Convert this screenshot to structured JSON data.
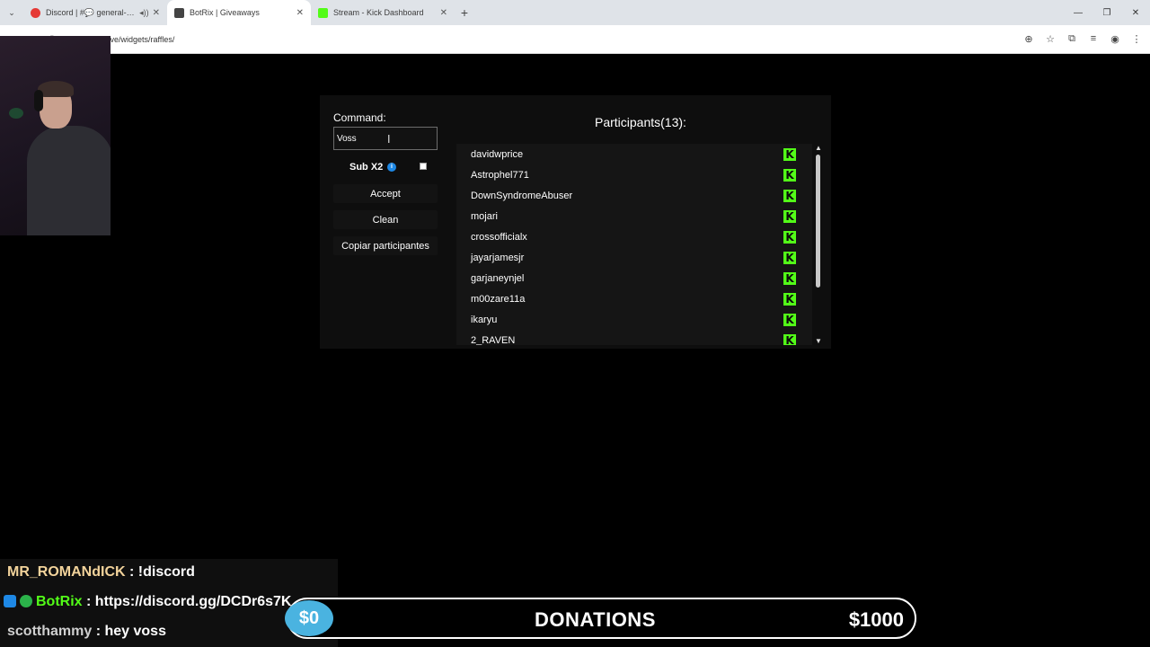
{
  "browser": {
    "tabs": [
      {
        "title": "Discord | #💬 general-cha",
        "favicon_color": "#e53935",
        "active": false,
        "audio": true
      },
      {
        "title": "BotRix | Giveaways",
        "favicon_color": "#444444",
        "active": true,
        "audio": false
      },
      {
        "title": "Stream - Kick Dashboard",
        "favicon_color": "#53fc18",
        "active": false,
        "audio": false
      }
    ],
    "url": "botrix.live/widgets/raffles/",
    "new_tab": "+"
  },
  "giveaway": {
    "command_label": "Command:",
    "command_value": "Voss",
    "subx2_label": "Sub X2",
    "subx2_checked": false,
    "accept_label": "Accept",
    "clean_label": "Clean",
    "copy_label": "Copiar participantes",
    "participants_title": "Participants(13):",
    "participants": [
      "davidwprice",
      "Astrophel771",
      "DownSyndromeAbuser",
      "mojari",
      "crossofficialx",
      "jayarjamesjr",
      "garjaneynjel",
      "m00zare11a",
      "ikaryu",
      "2_RAVEN"
    ],
    "platform_badge": "K"
  },
  "chat": [
    {
      "user": "MR_ROMANdICK",
      "message": ": !discord"
    },
    {
      "user": "BotRix",
      "message": ": https://discord.gg/DCDr6s7K"
    },
    {
      "user": "scotthammy",
      "message": ": hey voss"
    }
  ],
  "donations": {
    "current": "$0",
    "title": "DONATIONS",
    "goal": "$1000"
  },
  "colors": {
    "kick_green": "#53fc18",
    "donation_circle": "#4ab3e0"
  }
}
